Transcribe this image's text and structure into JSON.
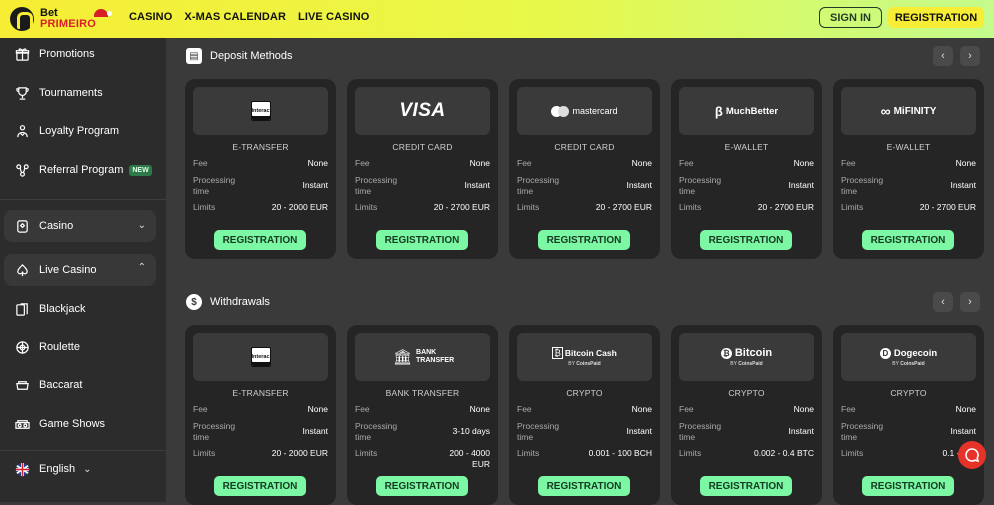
{
  "header": {
    "logo_line1": "Bet",
    "logo_line2": "PRIMEIRO",
    "nav": [
      "CASINO",
      "X-MAS CALENDAR",
      "LIVE CASINO"
    ],
    "sign_in": "SIGN IN",
    "registration": "REGISTRATION"
  },
  "sidebar": {
    "items": [
      {
        "label": "Promotions",
        "icon": "gift-icon"
      },
      {
        "label": "Tournaments",
        "icon": "trophy-icon"
      },
      {
        "label": "Loyalty Program",
        "icon": "loyalty-icon"
      },
      {
        "label": "Referral Program",
        "icon": "referral-icon",
        "badge": "NEW"
      }
    ],
    "casino": "Casino",
    "live_casino": "Live Casino",
    "live_items": [
      {
        "label": "Blackjack",
        "icon": "cards-icon"
      },
      {
        "label": "Roulette",
        "icon": "roulette-icon"
      },
      {
        "label": "Baccarat",
        "icon": "baccarat-icon"
      },
      {
        "label": "Game Shows",
        "icon": "game-shows-icon"
      }
    ],
    "language": "English"
  },
  "deposits": {
    "title": "Deposit Methods",
    "cards": [
      {
        "logo": "Interac",
        "method": "E-TRANSFER",
        "fee": "None",
        "time": "Instant",
        "limits": "20 - 2000 EUR"
      },
      {
        "logo": "VISA",
        "method": "CREDIT CARD",
        "fee": "None",
        "time": "Instant",
        "limits": "20 - 2700 EUR"
      },
      {
        "logo": "mastercard",
        "method": "CREDIT CARD",
        "fee": "None",
        "time": "Instant",
        "limits": "20 - 2700 EUR"
      },
      {
        "logo": "MuchBetter",
        "method": "E-WALLET",
        "fee": "None",
        "time": "Instant",
        "limits": "20 - 2700 EUR"
      },
      {
        "logo": "MiFINITY",
        "method": "E-WALLET",
        "fee": "None",
        "time": "Instant",
        "limits": "20 - 2700 EUR"
      }
    ]
  },
  "withdrawals": {
    "title": "Withdrawals",
    "cards": [
      {
        "logo": "Interac",
        "method": "E-TRANSFER",
        "fee": "None",
        "time": "Instant",
        "limits": "20 - 2000 EUR"
      },
      {
        "logo": "BANK TRANSFER",
        "method": "BANK TRANSFER",
        "fee": "None",
        "time": "3-10 days",
        "limits": "200 - 4000 EUR"
      },
      {
        "logo": "Bitcoin Cash",
        "method": "CRYPTO",
        "fee": "None",
        "time": "Instant",
        "limits": "0.001 - 100 BCH"
      },
      {
        "logo": "Bitcoin",
        "method": "CRYPTO",
        "fee": "None",
        "time": "Instant",
        "limits": "0.002 - 0.4 BTC"
      },
      {
        "logo": "Dogecoin",
        "method": "CRYPTO",
        "fee": "None",
        "time": "Instant",
        "limits": "0.1 - 100"
      }
    ]
  },
  "labels": {
    "fee": "Fee",
    "processing": "Processing",
    "time": "time",
    "limits": "Limits",
    "register": "REGISTRATION",
    "by": "BY",
    "coinspaid": "CoinsPaid"
  },
  "colors": {
    "accent_yellow": "#f7ed34",
    "accent_green": "#7cf7a4",
    "card_bg": "#252525",
    "chat_red": "#e6332a"
  }
}
